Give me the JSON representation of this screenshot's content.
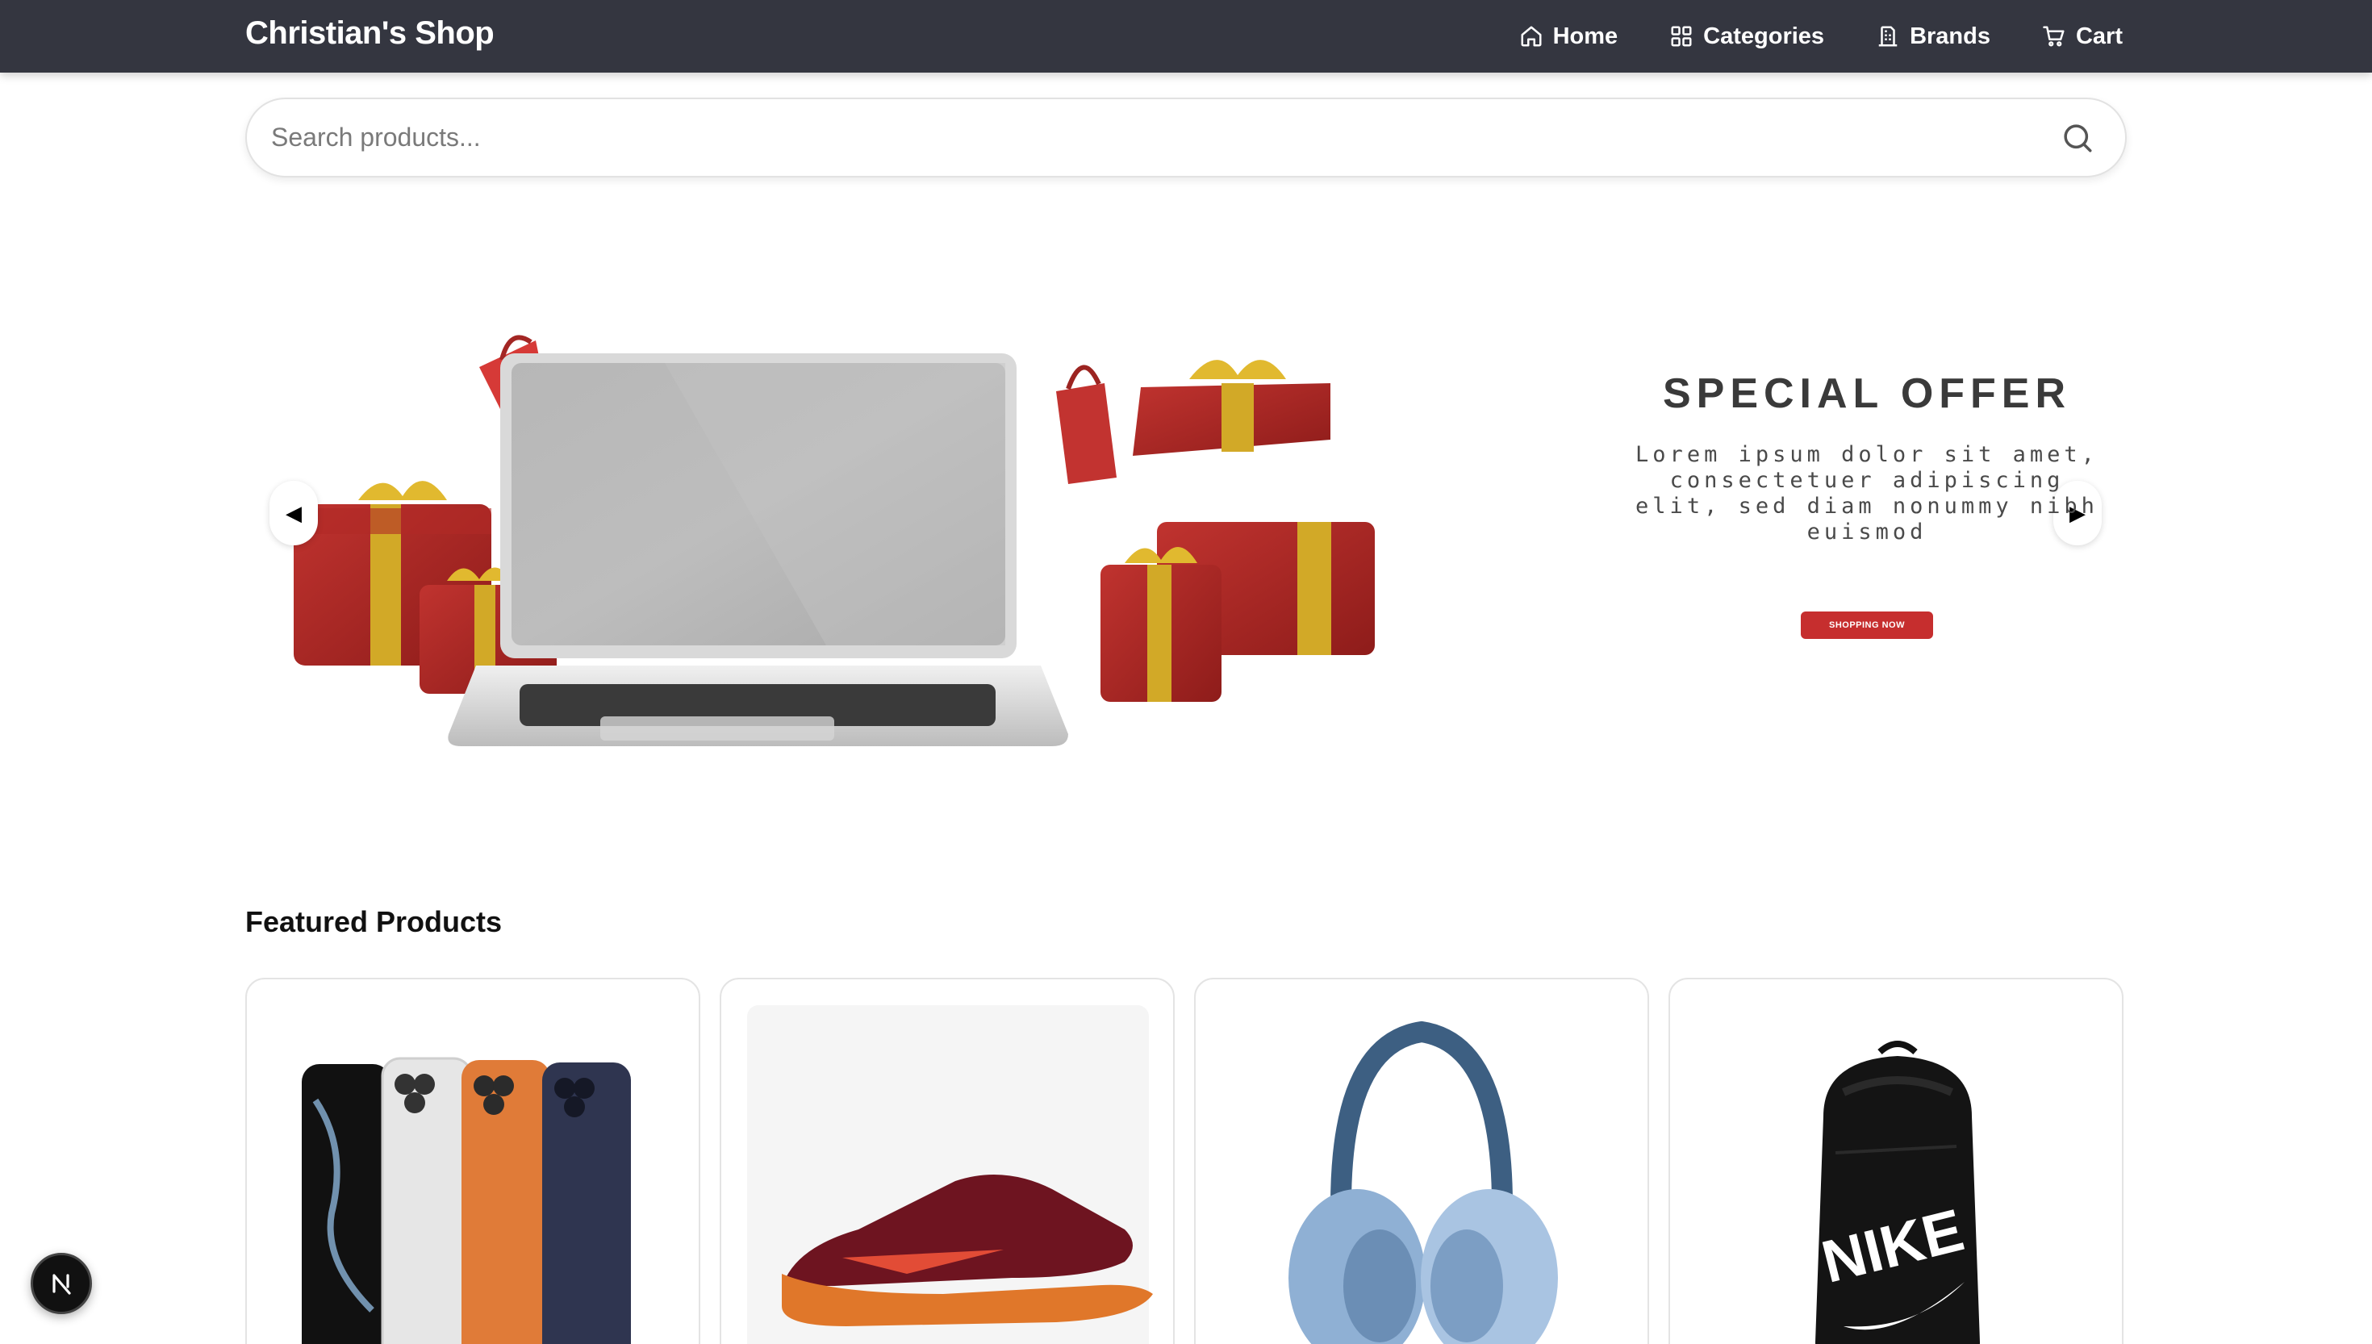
{
  "navbar": {
    "brand": "Christian's Shop",
    "links": [
      {
        "label": "Home",
        "icon": "home-icon"
      },
      {
        "label": "Categories",
        "icon": "grid-icon"
      },
      {
        "label": "Brands",
        "icon": "building-icon"
      },
      {
        "label": "Cart",
        "icon": "cart-icon"
      }
    ],
    "background": "#343640"
  },
  "search": {
    "placeholder": "Search products..."
  },
  "hero": {
    "title": "SPECIAL OFFER",
    "text": "Lorem ipsum dolor sit amet, consectetuer adipiscing elit, sed diam nonummy nibh euismod",
    "button": "SHOPPING NOW",
    "prev_label": "◀",
    "next_label": "▶",
    "accent": "#c62e2e"
  },
  "featured": {
    "title": "Featured Products",
    "products": [
      {
        "image": "smartphones"
      },
      {
        "image": "running-shoe"
      },
      {
        "image": "over-ear-headphones"
      },
      {
        "image": "nike-backpack",
        "logo_text": "NIKE"
      }
    ]
  },
  "badge": {
    "label": "N"
  }
}
